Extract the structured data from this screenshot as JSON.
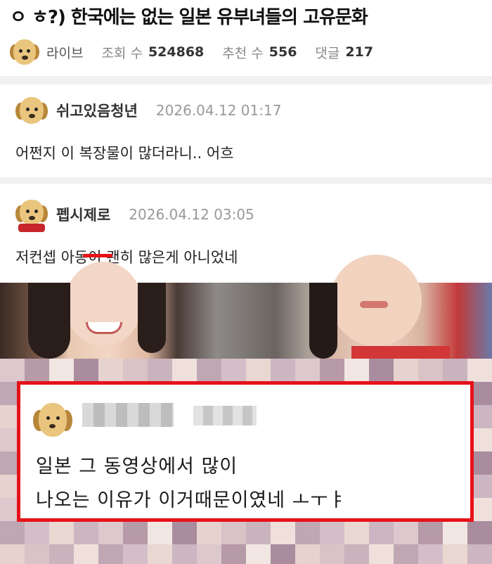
{
  "post": {
    "title": "ㅇ ㅎ?) 한국에는 없는 일본 유부녀들의 고유문화",
    "author": "라이브",
    "views_label": "조회 수",
    "views": "524868",
    "recommend_label": "추천 수",
    "recommend": "556",
    "comments_label": "댓글",
    "comments": "217"
  },
  "comments": [
    {
      "name": "쉬고있음청년",
      "date": "2026.04.12 01:17",
      "text": "어쩐지 이 복장물이 많더라니.. 어흐"
    },
    {
      "name": "펩시제로",
      "date": "2026.04.12 03:05",
      "text_before": "저컨셉 ",
      "text_struck": "아동",
      "text_after": "이 괜히 많은게 아니었네"
    }
  ],
  "highlight": {
    "line1": "일본 그 동영상에서 많이",
    "line2": "나오는 이유가 이거때문이였네 ㅗㅜㅑ",
    "border_color": "#e6121a"
  }
}
